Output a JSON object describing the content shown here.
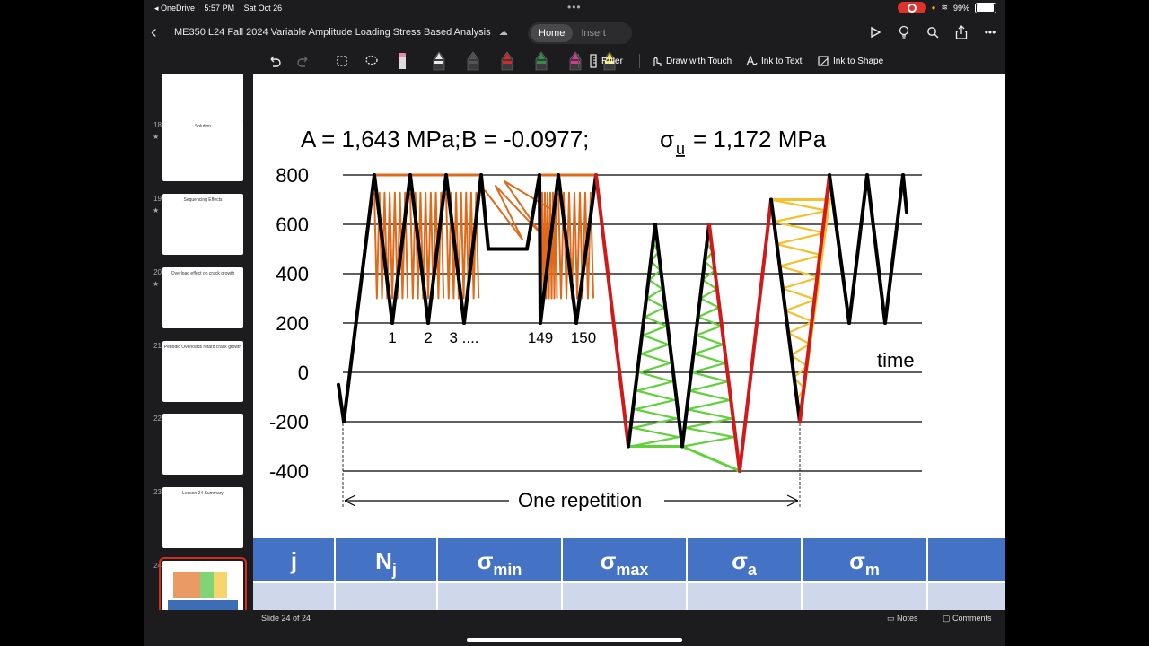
{
  "status": {
    "app_back": "◂ OneDrive",
    "time": "5:57 PM",
    "date": "Sat Oct 26",
    "battery": "99%"
  },
  "document": {
    "title": "ME350 L24 Fall 2024 Variable Amplitude Loading Stress Based Analysis"
  },
  "ribbon_tabs": [
    {
      "label": "Home",
      "active": true
    },
    {
      "label": "Insert",
      "active": false
    }
  ],
  "toolbar": {
    "ruler": "Ruler",
    "draw_touch": "Draw with Touch",
    "ink_text": "Ink to Text",
    "ink_shape": "Ink to Shape"
  },
  "pen_colors": [
    "#e8e8e8",
    "#555555",
    "#d8262a",
    "#2f8f46",
    "#d9368f",
    "#f0e03c"
  ],
  "thumbnails": [
    {
      "num": "",
      "star": false,
      "title": ""
    },
    {
      "num": "18",
      "star": true,
      "title": "Solution"
    },
    {
      "num": "19",
      "star": true,
      "title": "Sequencing Effects"
    },
    {
      "num": "20",
      "star": true,
      "title": "Overload effect on crack growth"
    },
    {
      "num": "21",
      "star": false,
      "title": "Periodic Overloads retard crack growth"
    },
    {
      "num": "22",
      "star": false,
      "title": ""
    },
    {
      "num": "23",
      "star": false,
      "title": "Lesson 24 Summary"
    },
    {
      "num": "24",
      "star": false,
      "title": "",
      "selected": true
    }
  ],
  "slide": {
    "equation_a": "A = 1,643 MPa;",
    "equation_b": "B = -0.0977;",
    "equation_s": "σ",
    "equation_s_sub": "u",
    "equation_s_val": "= 1,172 MPa",
    "cycle_labels": [
      "1",
      "2",
      "3 ....",
      "149",
      "150"
    ],
    "time_label": "time",
    "repetition_label": "One repetition",
    "table_headers": [
      {
        "sym": "j",
        "sub": ""
      },
      {
        "sym": "N",
        "sub": "j"
      },
      {
        "sym": "σ",
        "sub": "min"
      },
      {
        "sym": "σ",
        "sub": "max"
      },
      {
        "sym": "σ",
        "sub": "a"
      },
      {
        "sym": "σ",
        "sub": "m"
      },
      {
        "sym": "",
        "sub": ""
      }
    ]
  },
  "chart_data": {
    "type": "line",
    "yticks": [
      "800",
      "600",
      "400",
      "200",
      "0",
      "-200",
      "-400"
    ],
    "ylim": [
      -400,
      800
    ],
    "series": [
      {
        "values": [
          -50,
          -200,
          800,
          200,
          800,
          200,
          800,
          200,
          800,
          500,
          500,
          500,
          800,
          200,
          800,
          200,
          800,
          -300,
          600,
          -300,
          600,
          -400,
          700,
          -200,
          800,
          200,
          800,
          200,
          800,
          650
        ]
      }
    ]
  },
  "bottom": {
    "slide_count": "Slide 24 of 24",
    "notes": "Notes",
    "comments": "Comments"
  }
}
